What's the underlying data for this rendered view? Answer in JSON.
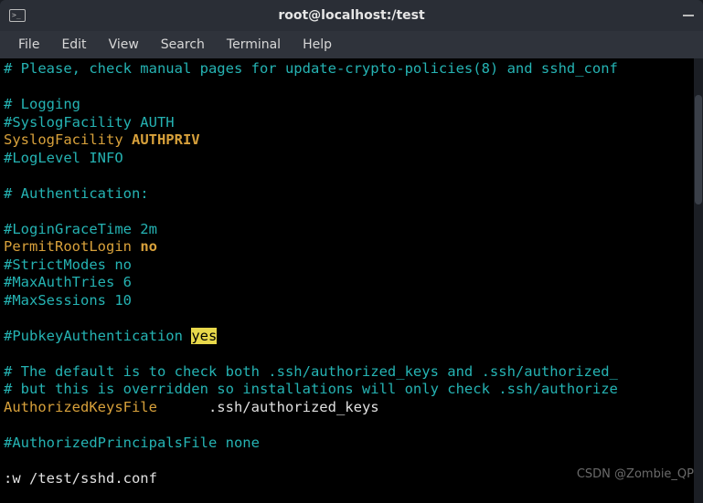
{
  "window": {
    "title": "root@localhost:/test"
  },
  "menubar": {
    "items": [
      "File",
      "Edit",
      "View",
      "Search",
      "Terminal",
      "Help"
    ]
  },
  "editor": {
    "lines": [
      {
        "segs": [
          {
            "t": "# Please, check manual pages for update-crypto-policies(8) and sshd_conf",
            "cls": "c-comment"
          }
        ]
      },
      {
        "segs": [
          {
            "t": " ",
            "cls": ""
          }
        ]
      },
      {
        "segs": [
          {
            "t": "# Logging",
            "cls": "c-comment"
          }
        ]
      },
      {
        "segs": [
          {
            "t": "#SyslogFacility AUTH",
            "cls": "c-comment"
          }
        ]
      },
      {
        "segs": [
          {
            "t": "SyslogFacility ",
            "cls": "c-key"
          },
          {
            "t": "AUTHPRIV",
            "cls": "c-val"
          }
        ]
      },
      {
        "segs": [
          {
            "t": "#LogLevel INFO",
            "cls": "c-comment"
          }
        ]
      },
      {
        "segs": [
          {
            "t": " ",
            "cls": ""
          }
        ]
      },
      {
        "segs": [
          {
            "t": "# Authentication:",
            "cls": "c-comment"
          }
        ]
      },
      {
        "segs": [
          {
            "t": " ",
            "cls": ""
          }
        ]
      },
      {
        "segs": [
          {
            "t": "#LoginGraceTime 2m",
            "cls": "c-comment"
          }
        ]
      },
      {
        "segs": [
          {
            "t": "PermitRootLogin ",
            "cls": "c-key"
          },
          {
            "t": "no",
            "cls": "c-val"
          }
        ]
      },
      {
        "segs": [
          {
            "t": "#StrictModes no",
            "cls": "c-comment"
          }
        ]
      },
      {
        "segs": [
          {
            "t": "#MaxAuthTries 6",
            "cls": "c-comment"
          }
        ]
      },
      {
        "segs": [
          {
            "t": "#MaxSessions 10",
            "cls": "c-comment"
          }
        ]
      },
      {
        "segs": [
          {
            "t": " ",
            "cls": ""
          }
        ]
      },
      {
        "segs": [
          {
            "t": "#PubkeyAuthentication ",
            "cls": "c-comment"
          },
          {
            "t": "yes",
            "cls": "hl"
          }
        ]
      },
      {
        "segs": [
          {
            "t": " ",
            "cls": ""
          }
        ]
      },
      {
        "segs": [
          {
            "t": "# The default is to check both .ssh/authorized_keys and .ssh/authorized_",
            "cls": "c-comment"
          }
        ]
      },
      {
        "segs": [
          {
            "t": "# but this is overridden so installations will only check .ssh/authorize",
            "cls": "c-comment"
          }
        ]
      },
      {
        "segs": [
          {
            "t": "AuthorizedKeysFile",
            "cls": "c-key"
          },
          {
            "t": "      .ssh/authorized_keys",
            "cls": ""
          }
        ]
      },
      {
        "segs": [
          {
            "t": " ",
            "cls": ""
          }
        ]
      },
      {
        "segs": [
          {
            "t": "#AuthorizedPrincipalsFile none",
            "cls": "c-comment"
          }
        ]
      },
      {
        "segs": [
          {
            "t": " ",
            "cls": ""
          }
        ]
      },
      {
        "segs": [
          {
            "t": ":w /test/sshd.conf",
            "cls": ""
          }
        ]
      }
    ]
  },
  "watermark": "CSDN @Zombie_QP"
}
